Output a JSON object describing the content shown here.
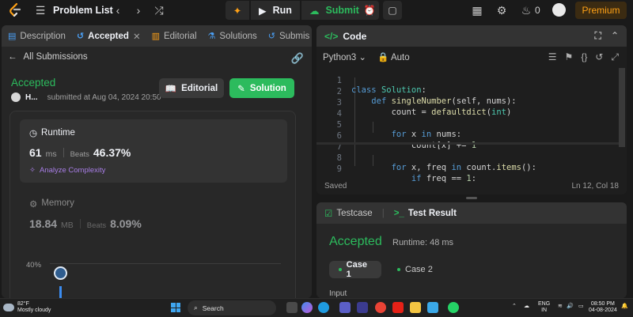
{
  "topbar": {
    "title": "Problem List",
    "run_label": "Run",
    "submit_label": "Submit",
    "streak_count": "0",
    "premium_label": "Premium"
  },
  "left_tabs": [
    {
      "label": "Description"
    },
    {
      "label": "Accepted"
    },
    {
      "label": "Editorial"
    },
    {
      "label": "Solutions"
    },
    {
      "label": "Submis"
    }
  ],
  "submission": {
    "back_label": "All Submissions",
    "status": "Accepted",
    "user_initial": "H...",
    "submitted_text": "submitted at Aug 04, 2024 20:50",
    "editorial_button": "Editorial",
    "solution_button": "Solution"
  },
  "runtime": {
    "title": "Runtime",
    "value": "61",
    "unit": "ms",
    "beats_label": "Beats",
    "beats_value": "46.37%",
    "analyze_label": "Analyze Complexity"
  },
  "memory": {
    "title": "Memory",
    "value": "18.84",
    "unit": "MB",
    "beats_label": "Beats",
    "beats_value": "8.09%"
  },
  "chart": {
    "y_label": "40%"
  },
  "code_panel": {
    "title": "Code",
    "language": "Python3",
    "mode": "Auto",
    "saved_text": "Saved",
    "cursor_position": "Ln 12, Col 18"
  },
  "code_lines": [
    {
      "n": "1",
      "text": "class Solution:"
    },
    {
      "n": "2",
      "text": "    def singleNumber(self, nums):"
    },
    {
      "n": "3",
      "text": "        count = defaultdict(int)"
    },
    {
      "n": "4",
      "text": ""
    },
    {
      "n": "5",
      "text": "        for x in nums:"
    },
    {
      "n": "6",
      "text": "            count[x] += 1"
    },
    {
      "n": "7",
      "text": ""
    },
    {
      "n": "8",
      "text": "        for x, freq in count.items():"
    },
    {
      "n": "9",
      "text": "            if freq == 1:"
    }
  ],
  "test_panel": {
    "testcase_tab": "Testcase",
    "result_tab": "Test Result",
    "status": "Accepted",
    "runtime_text": "Runtime: 48 ms",
    "case1": "Case 1",
    "case2": "Case 2",
    "input_label": "Input"
  },
  "taskbar": {
    "temp": "82°F",
    "weather": "Mostly cloudy",
    "search_placeholder": "Search",
    "lang_top": "ENG",
    "lang_bottom": "IN",
    "time": "08:50 PM",
    "date": "04-08-2024"
  },
  "colors": {
    "accent_green": "#2cbb5d",
    "premium_orange": "#ffa116",
    "analyze_purple": "#a87ee6"
  }
}
